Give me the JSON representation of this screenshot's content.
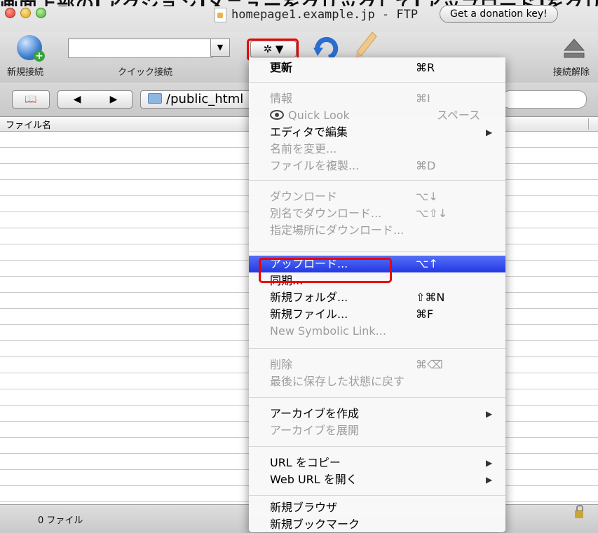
{
  "caption": "画面上部の[アクション]メニューをクリックして[アップロード]をクリック",
  "window": {
    "title": "homepage1.example.jp - FTP",
    "donation_button": "Get a donation key!"
  },
  "toolbar": {
    "new_connection_label": "新規接続",
    "quick_connect_label": "クイック接続",
    "quick_connect_value": "",
    "action_button_label": "✲ ▼",
    "disconnect_label": "接続解除"
  },
  "pathbar": {
    "bookmark_label": "📖",
    "back_label": "◀",
    "forward_label": "▶",
    "path": "/public_html"
  },
  "file_list": {
    "column_filename": "ファイル名"
  },
  "status": {
    "file_count": "0 ファイル"
  },
  "menu": {
    "items": [
      {
        "label": "更新",
        "shortcut": "⌘R"
      },
      {
        "label": "情報",
        "shortcut": "⌘I"
      },
      {
        "label": "Quick Look",
        "shortcut": "スペース"
      },
      {
        "label": "エディタで編集",
        "shortcut": ""
      },
      {
        "label": "名前を変更...",
        "shortcut": ""
      },
      {
        "label": "ファイルを複製...",
        "shortcut": "⌘D"
      },
      {
        "label": "ダウンロード",
        "shortcut": "⌥↓"
      },
      {
        "label": "別名でダウンロード...",
        "shortcut": "⌥⇧↓"
      },
      {
        "label": "指定場所にダウンロード...",
        "shortcut": ""
      },
      {
        "label": "アップロード...",
        "shortcut": "⌥↑"
      },
      {
        "label": "同期...",
        "shortcut": ""
      },
      {
        "label": "新規フォルダ...",
        "shortcut": "⇧⌘N"
      },
      {
        "label": "新規ファイル...",
        "shortcut": "⌘F"
      },
      {
        "label": "New Symbolic Link...",
        "shortcut": ""
      },
      {
        "label": "削除",
        "shortcut": "⌘⌫"
      },
      {
        "label": "最後に保存した状態に戻す",
        "shortcut": ""
      },
      {
        "label": "アーカイブを作成",
        "shortcut": ""
      },
      {
        "label": "アーカイブを展開",
        "shortcut": ""
      },
      {
        "label": "URL をコピー",
        "shortcut": ""
      },
      {
        "label": "Web URL を開く",
        "shortcut": ""
      },
      {
        "label": "新規ブラウザ",
        "shortcut": ""
      },
      {
        "label": "新規ブックマーク",
        "shortcut": ""
      }
    ]
  },
  "colors": {
    "highlight_red": "#e00000",
    "menu_selected": "#2437e3"
  }
}
